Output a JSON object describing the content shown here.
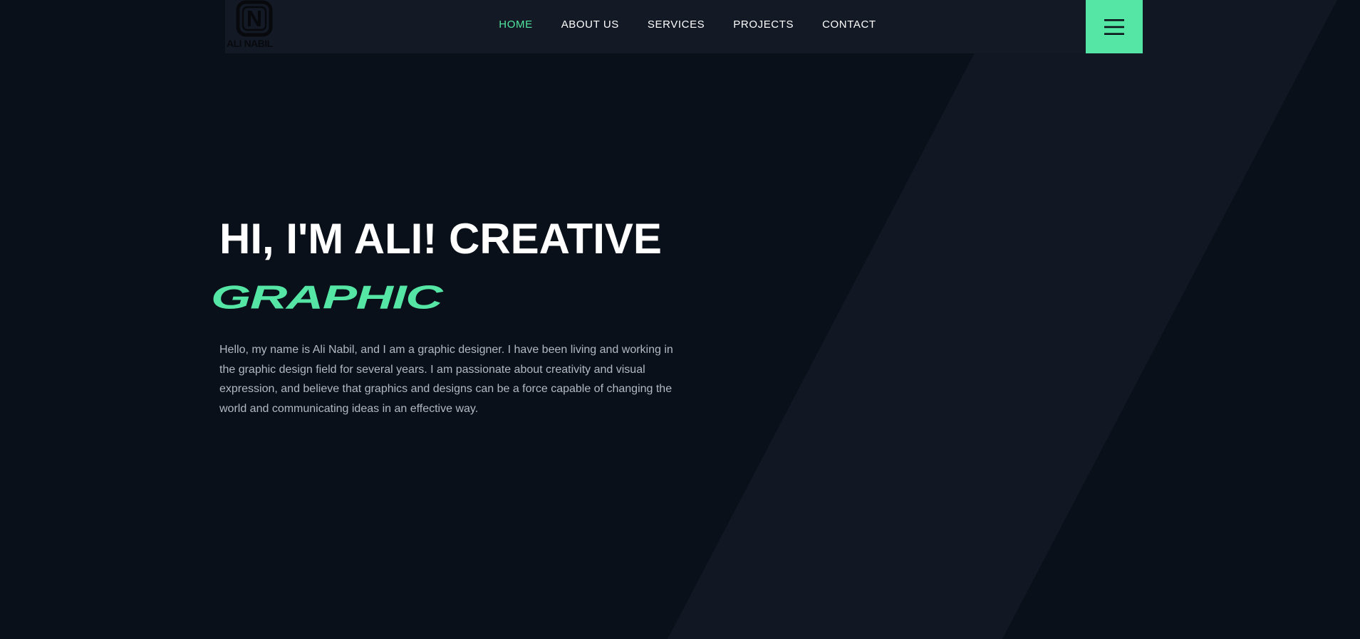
{
  "brand": {
    "logo_letter": "N",
    "logo_text": "ALI NABIL"
  },
  "nav": {
    "items": [
      {
        "label": "HOME",
        "active": true
      },
      {
        "label": "ABOUT US",
        "active": false
      },
      {
        "label": "SERVICES",
        "active": false
      },
      {
        "label": "PROJECTS",
        "active": false
      },
      {
        "label": "CONTACT",
        "active": false
      }
    ],
    "menu_icon": "hamburger-menu-icon"
  },
  "hero": {
    "title": "HI, I'M ALI! CREATIVE",
    "accent": "GRAPHIC",
    "paragraph": "Hello, my name is Ali Nabil, and I am a graphic designer. I have been living and working in the graphic design field for several years. I am passionate about creativity and visual expression, and believe that graphics and designs can be a force capable of changing the world and communicating ideas in an effective way."
  },
  "colors": {
    "background": "#0a101a",
    "navbar": "#131a26",
    "accent": "#55e6a5",
    "stripe": "#111723",
    "text_primary": "#ffffff",
    "text_muted": "#b3b8c2"
  }
}
